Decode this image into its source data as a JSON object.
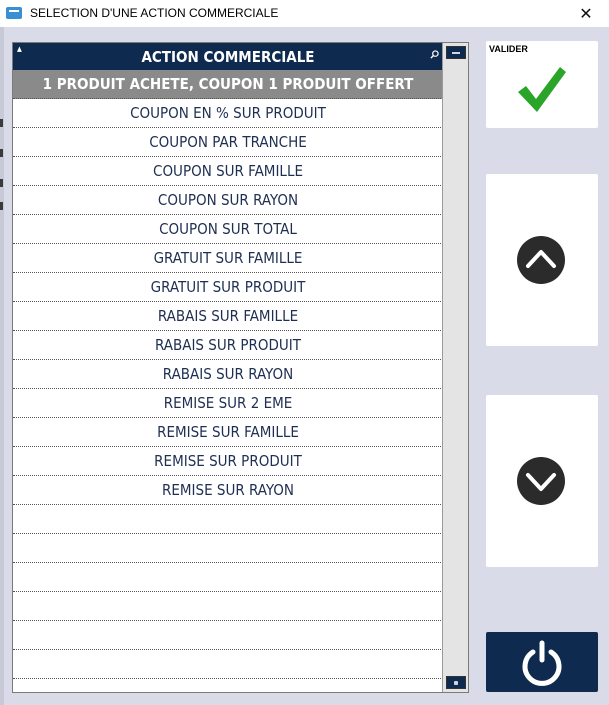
{
  "window": {
    "title": "SELECTION D'UNE ACTION COMMERCIALE",
    "close_glyph": "✕"
  },
  "list": {
    "header": "ACTION COMMERCIALE",
    "rows": [
      "1 PRODUIT ACHETE, COUPON 1 PRODUIT OFFERT",
      "COUPON EN % SUR PRODUIT",
      "COUPON PAR TRANCHE",
      "COUPON SUR FAMILLE",
      "COUPON SUR RAYON",
      "COUPON SUR TOTAL",
      "GRATUIT SUR FAMILLE",
      "GRATUIT SUR PRODUIT",
      "RABAIS SUR FAMILLE",
      "RABAIS SUR PRODUIT",
      "RABAIS SUR RAYON",
      "REMISE SUR 2 EME",
      "REMISE SUR FAMILLE",
      "REMISE SUR PRODUIT",
      "REMISE SUR RAYON",
      "",
      "",
      "",
      "",
      "",
      "",
      ""
    ],
    "selected_index": 0
  },
  "buttons": {
    "validate_label": "VALIDER",
    "icons": {
      "validate": "check-icon",
      "up": "chevron-up-icon",
      "down": "chevron-down-icon",
      "exit": "power-icon"
    }
  },
  "colors": {
    "header_bg": "#0e2a4e",
    "selected_row_bg": "#8a8a8a",
    "row_text": "#1f2f52",
    "check_green": "#2aa52a",
    "circle_icon": "#2b2b2b",
    "panel_bg": "#d9dbe8"
  }
}
